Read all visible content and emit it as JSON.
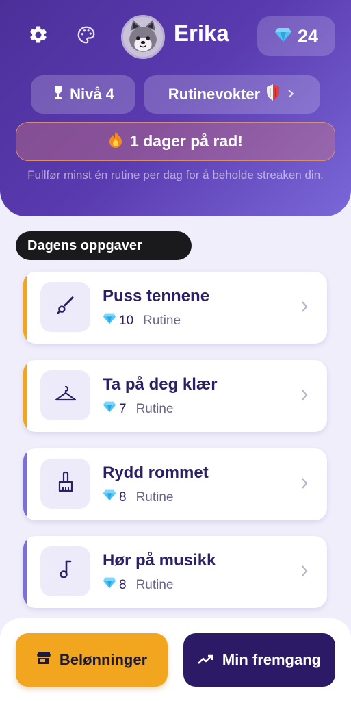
{
  "header": {
    "username": "Erika",
    "gems": "24",
    "level_label": "Nivå 4",
    "badge_label": "Rutinevokter",
    "streak_text": "1 dager på rad!",
    "streak_hint": "Fullfør minst én rutine per dag for å beholde streaken din."
  },
  "icons": {
    "settings": "gear-icon",
    "theme": "palette-icon",
    "gem": "diamond-icon",
    "level": "trophy-icon",
    "badge": "shield-icon",
    "streak": "flame-icon",
    "rewards": "store-icon",
    "progress": "trending-up-icon"
  },
  "section": {
    "title": "Dagens oppgaver"
  },
  "tasks": [
    {
      "title": "Puss tennene",
      "gems": "10",
      "tag": "Rutine",
      "icon": "brush-icon",
      "accent": "#f2a51f"
    },
    {
      "title": "Ta på deg klær",
      "gems": "7",
      "tag": "Rutine",
      "icon": "hanger-icon",
      "accent": "#f2a51f"
    },
    {
      "title": "Rydd rommet",
      "gems": "8",
      "tag": "Rutine",
      "icon": "broom-icon",
      "accent": "#7b6fd8"
    },
    {
      "title": "Hør på musikk",
      "gems": "8",
      "tag": "Rutine",
      "icon": "music-note-icon",
      "accent": "#7b6fd8"
    }
  ],
  "bottom": {
    "rewards_label": "Belønninger",
    "progress_label": "Min fremgang"
  },
  "colors": {
    "header_start": "#4d2f9a",
    "header_end": "#7a68d8",
    "accent_orange": "#f2a51f",
    "accent_purple": "#7b6fd8",
    "dark_purple": "#2d1a66"
  }
}
